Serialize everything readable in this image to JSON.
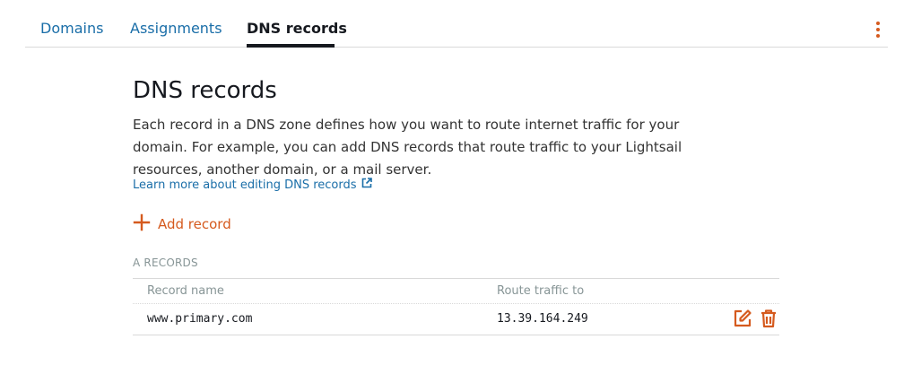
{
  "tabs": [
    {
      "label": "Domains"
    },
    {
      "label": "Assignments"
    },
    {
      "label": "DNS records",
      "active": true
    }
  ],
  "page": {
    "title": "DNS records",
    "description": "Each record in a DNS zone defines how you want to route internet traffic for your domain. For example, you can add DNS records that route traffic to your Lightsail resources, another domain, or a mail server.",
    "learn_more": "Learn more about editing DNS records",
    "add_record": "Add record"
  },
  "a_records": {
    "section_label": "A RECORDS",
    "columns": [
      "Record name",
      "Route traffic to"
    ],
    "rows": [
      {
        "name": "www.primary.com",
        "target": "13.39.164.249"
      }
    ]
  },
  "icons": {
    "menu": "kebab-menu-icon",
    "external_link": "external-link-icon",
    "add": "plus-icon",
    "edit": "edit-icon",
    "delete": "trash-icon"
  },
  "colors": {
    "accent": "#d55a1e",
    "link": "#1a6ea8",
    "text": "#16191f",
    "muted": "#879596"
  }
}
